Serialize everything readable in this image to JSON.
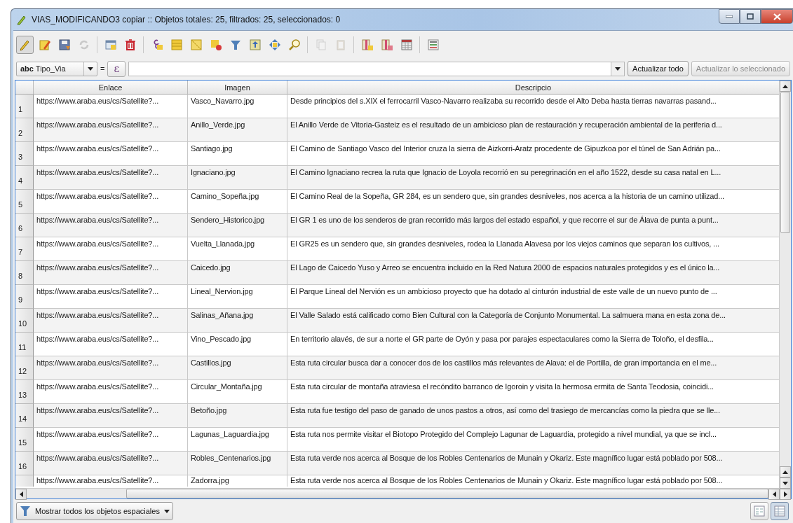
{
  "window": {
    "title": "VIAS_MODIFICANDO3 copiar :: Objetos totales: 25, filtrados: 25, seleccionados: 0"
  },
  "toolbar": [
    {
      "kind": "pencil",
      "on": true,
      "disabled": false
    },
    {
      "kind": "edit",
      "on": false,
      "disabled": false
    },
    {
      "kind": "save",
      "on": false,
      "disabled": false
    },
    {
      "kind": "refresh",
      "on": false,
      "disabled": true
    },
    {
      "kind": "sep"
    },
    {
      "kind": "table-calendar",
      "on": false,
      "disabled": false
    },
    {
      "kind": "trash",
      "on": false,
      "disabled": false
    },
    {
      "kind": "sep"
    },
    {
      "kind": "epsilon",
      "on": false,
      "disabled": false
    },
    {
      "kind": "rows",
      "on": false,
      "disabled": false
    },
    {
      "kind": "square",
      "on": false,
      "disabled": false
    },
    {
      "kind": "deselect",
      "on": false,
      "disabled": false
    },
    {
      "kind": "funnel",
      "on": false,
      "disabled": false
    },
    {
      "kind": "move-top",
      "on": false,
      "disabled": false
    },
    {
      "kind": "pan",
      "on": false,
      "disabled": false
    },
    {
      "kind": "zoom",
      "on": false,
      "disabled": false
    },
    {
      "kind": "sep"
    },
    {
      "kind": "copy",
      "on": false,
      "disabled": true
    },
    {
      "kind": "paste",
      "on": false,
      "disabled": true
    },
    {
      "kind": "sep"
    },
    {
      "kind": "column-add",
      "on": false,
      "disabled": false
    },
    {
      "kind": "column-delete",
      "on": false,
      "disabled": false
    },
    {
      "kind": "calc",
      "on": false,
      "disabled": false
    },
    {
      "kind": "sep"
    },
    {
      "kind": "form",
      "on": false,
      "disabled": false
    }
  ],
  "filter": {
    "type_tag": "abc",
    "field": "Tipo_Via",
    "operator": "=",
    "expression_button": "ε",
    "update_all": {
      "label": "Actualizar todo",
      "disabled": false
    },
    "update_selected": {
      "label": "Actualizar lo seleccionado",
      "disabled": true
    }
  },
  "table": {
    "columns": [
      "Enlace",
      "Imagen",
      "Descripcio"
    ],
    "rows": [
      {
        "num": "1",
        "cells": [
          "https://www.araba.eus/cs/Satellite?...",
          "Vasco_Navarro.jpg",
          "Desde principios del s.XIX el ferrocarril Vasco-Navarro realizaba su recorrido desde el Alto Deba hasta tierras navarras pasand..."
        ]
      },
      {
        "num": "2",
        "cells": [
          "https://www.araba.eus/cs/Satellite?...",
          "Anillo_Verde.jpg",
          "El Anillo Verde de Vitoria-Gasteiz es el resultado de un ambicioso plan de restauración y recuperación ambiental de la periferia d..."
        ]
      },
      {
        "num": "3",
        "cells": [
          "https://www.araba.eus/cs/Satellite?...",
          "Santiago.jpg",
          "El Camino de Santiago Vasco del Interior cruza la sierra de Aizkorri-Aratz procedente de Gipuzkoa por el túnel de San Adrián pa..."
        ]
      },
      {
        "num": "4",
        "cells": [
          "https://www.araba.eus/cs/Satellite?...",
          "Ignaciano.jpg",
          "El Camino Ignaciano recrea la ruta que Ignacio de Loyola recorrió en su peregrinación en el año 1522, desde su casa natal en L..."
        ]
      },
      {
        "num": "5",
        "cells": [
          "https://www.araba.eus/cs/Satellite?...",
          "Camino_Sopeña.jpg",
          "El Camino Real de la Sopeña, GR 284, es un sendero que, sin grandes desniveles, nos acerca a la historia de un camino utilizad..."
        ]
      },
      {
        "num": "6",
        "cells": [
          "https://www.araba.eus/cs/Satellite?...",
          "Sendero_Historico.jpg",
          "El GR 1 es uno de los senderos de gran recorrido más largos del estado español, y que recorre el sur de Álava de punta a punt..."
        ]
      },
      {
        "num": "7",
        "cells": [
          "https://www.araba.eus/cs/Satellite?...",
          "Vuelta_Llanada.jpg",
          "El GR25 es un sendero que, sin grandes desniveles, rodea la Llanada Alavesa por los viejos caminos que separan los cultivos, ..."
        ]
      },
      {
        "num": "8",
        "cells": [
          "https://www.araba.eus/cs/Satellite?...",
          "Caicedo.jpg",
          "El Lago de Caicedo Yuso y Arreo se encuentra incluido en la Red Natura 2000 de espacios naturales protegidos y es el único la..."
        ]
      },
      {
        "num": "9",
        "cells": [
          "https://www.araba.eus/cs/Satellite?...",
          "Lineal_Nervion.jpg",
          "El Parque Lineal del Nervión es un ambicioso proyecto que ha dotado al cinturón industrial de este valle de un nuevo punto de ..."
        ]
      },
      {
        "num": "10",
        "cells": [
          "https://www.araba.eus/cs/Satellite?...",
          "Salinas_Añana.jpg",
          "El Valle Salado está calificado como Bien Cultural con la Categoría de Conjunto Monumental. La salmuera mana en esta zona de..."
        ]
      },
      {
        "num": "11",
        "cells": [
          "https://www.araba.eus/cs/Satellite?...",
          "Vino_Pescado.jpg",
          "En territorio alavés, de sur a norte el GR parte de Oyón y pasa por parajes espectaculares como la Sierra de Toloño, el desfila..."
        ]
      },
      {
        "num": "12",
        "cells": [
          "https://www.araba.eus/cs/Satellite?...",
          "Castillos.jpg",
          "Esta ruta circular busca dar a conocer dos de los castillos más relevantes de Alava: el de Portilla, de gran importancia en el me..."
        ]
      },
      {
        "num": "13",
        "cells": [
          "https://www.araba.eus/cs/Satellite?...",
          "Circular_Montaña.jpg",
          "Esta ruta circular de montaña atraviesa el recóndito barranco de Igoroin y visita la hermosa ermita de Santa Teodosia, coincidi..."
        ]
      },
      {
        "num": "14",
        "cells": [
          "https://www.araba.eus/cs/Satellite?...",
          "Betoño.jpg",
          "Esta ruta fue testigo del paso de ganado de unos pastos a otros, así como del trasiego de mercancías como la piedra que se lle..."
        ]
      },
      {
        "num": "15",
        "cells": [
          "https://www.araba.eus/cs/Satellite?...",
          "Lagunas_Laguardia.jpg",
          "Esta ruta nos permite visitar el Biotopo Protegido del Complejo Lagunar de Laguardia, protegido a nivel mundial, ya que se incl..."
        ]
      },
      {
        "num": "16",
        "cells": [
          "https://www.araba.eus/cs/Satellite?...",
          "Robles_Centenarios.jpg",
          "Esta ruta verde nos acerca al Bosque de los Robles Centenarios de Munain y Okariz. Este magnífico lugar está poblado por 508..."
        ]
      },
      {
        "cells": [
          "https://www.araba.eus/cs/Satellite?...",
          "Zadorra.jpg",
          "Esta ruta verde nos acerca al Bosque de los Robles Centenarios de Munain y Okariz. Este magnífico lugar está poblado por 508..."
        ]
      }
    ]
  },
  "footer": {
    "filter_button": "Mostrar todos los objetos espaciales",
    "views": [
      {
        "kind": "form",
        "selected": false
      },
      {
        "kind": "table",
        "selected": true
      }
    ]
  }
}
